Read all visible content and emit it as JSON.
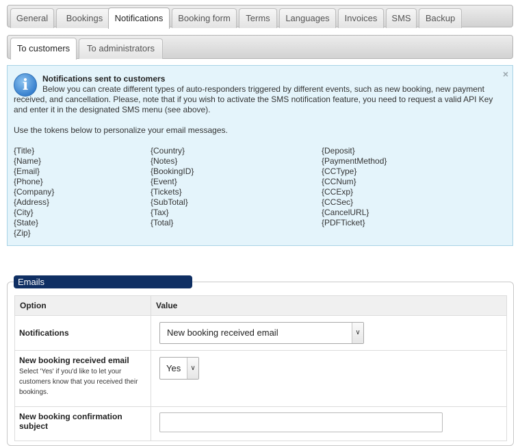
{
  "tabs": [
    "General",
    "Bookings",
    "Notifications",
    "Booking form",
    "Terms",
    "Languages",
    "Invoices",
    "SMS",
    "Backup"
  ],
  "subtabs": [
    "To customers",
    "To administrators"
  ],
  "info": {
    "icon": "info-icon",
    "close": "×",
    "title": "Notifications sent to customers",
    "text": "Below you can create different types of auto-responders triggered by different events, such as new booking, new payment received, and cancellation. Please, note that if you wish to activate the SMS notification feature, you need to request a valid API Key and enter it in the designated SMS menu (see above).",
    "tokens_intro": "Use the tokens below to personalize your email messages.",
    "tokens": {
      "col1": [
        "{Title}",
        "{Name}",
        "{Email}",
        "{Phone}",
        "{Company}",
        "{Address}",
        "{City}",
        "{State}",
        "{Zip}"
      ],
      "col2": [
        "{Country}",
        "{Notes}",
        "{BookingID}",
        "{Event}",
        "{Tickets}",
        "{SubTotal}",
        "{Tax}",
        "{Total}"
      ],
      "col3": [
        "{Deposit}",
        "{PaymentMethod}",
        "{CCType}",
        "{CCNum}",
        "{CCExp}",
        "{CCSec}",
        "{CancelURL}",
        "{PDFTicket}"
      ]
    }
  },
  "emails": {
    "legend": "Emails",
    "header_option": "Option",
    "header_value": "Value",
    "rows": {
      "notifications": {
        "label": "Notifications",
        "selected": "New booking received email"
      },
      "received": {
        "label": "New booking received email",
        "hint": "Select 'Yes' if you'd like to let your customers know that you received their bookings.",
        "selected": "Yes"
      },
      "subject": {
        "label": "New booking confirmation subject",
        "value": ""
      }
    }
  }
}
